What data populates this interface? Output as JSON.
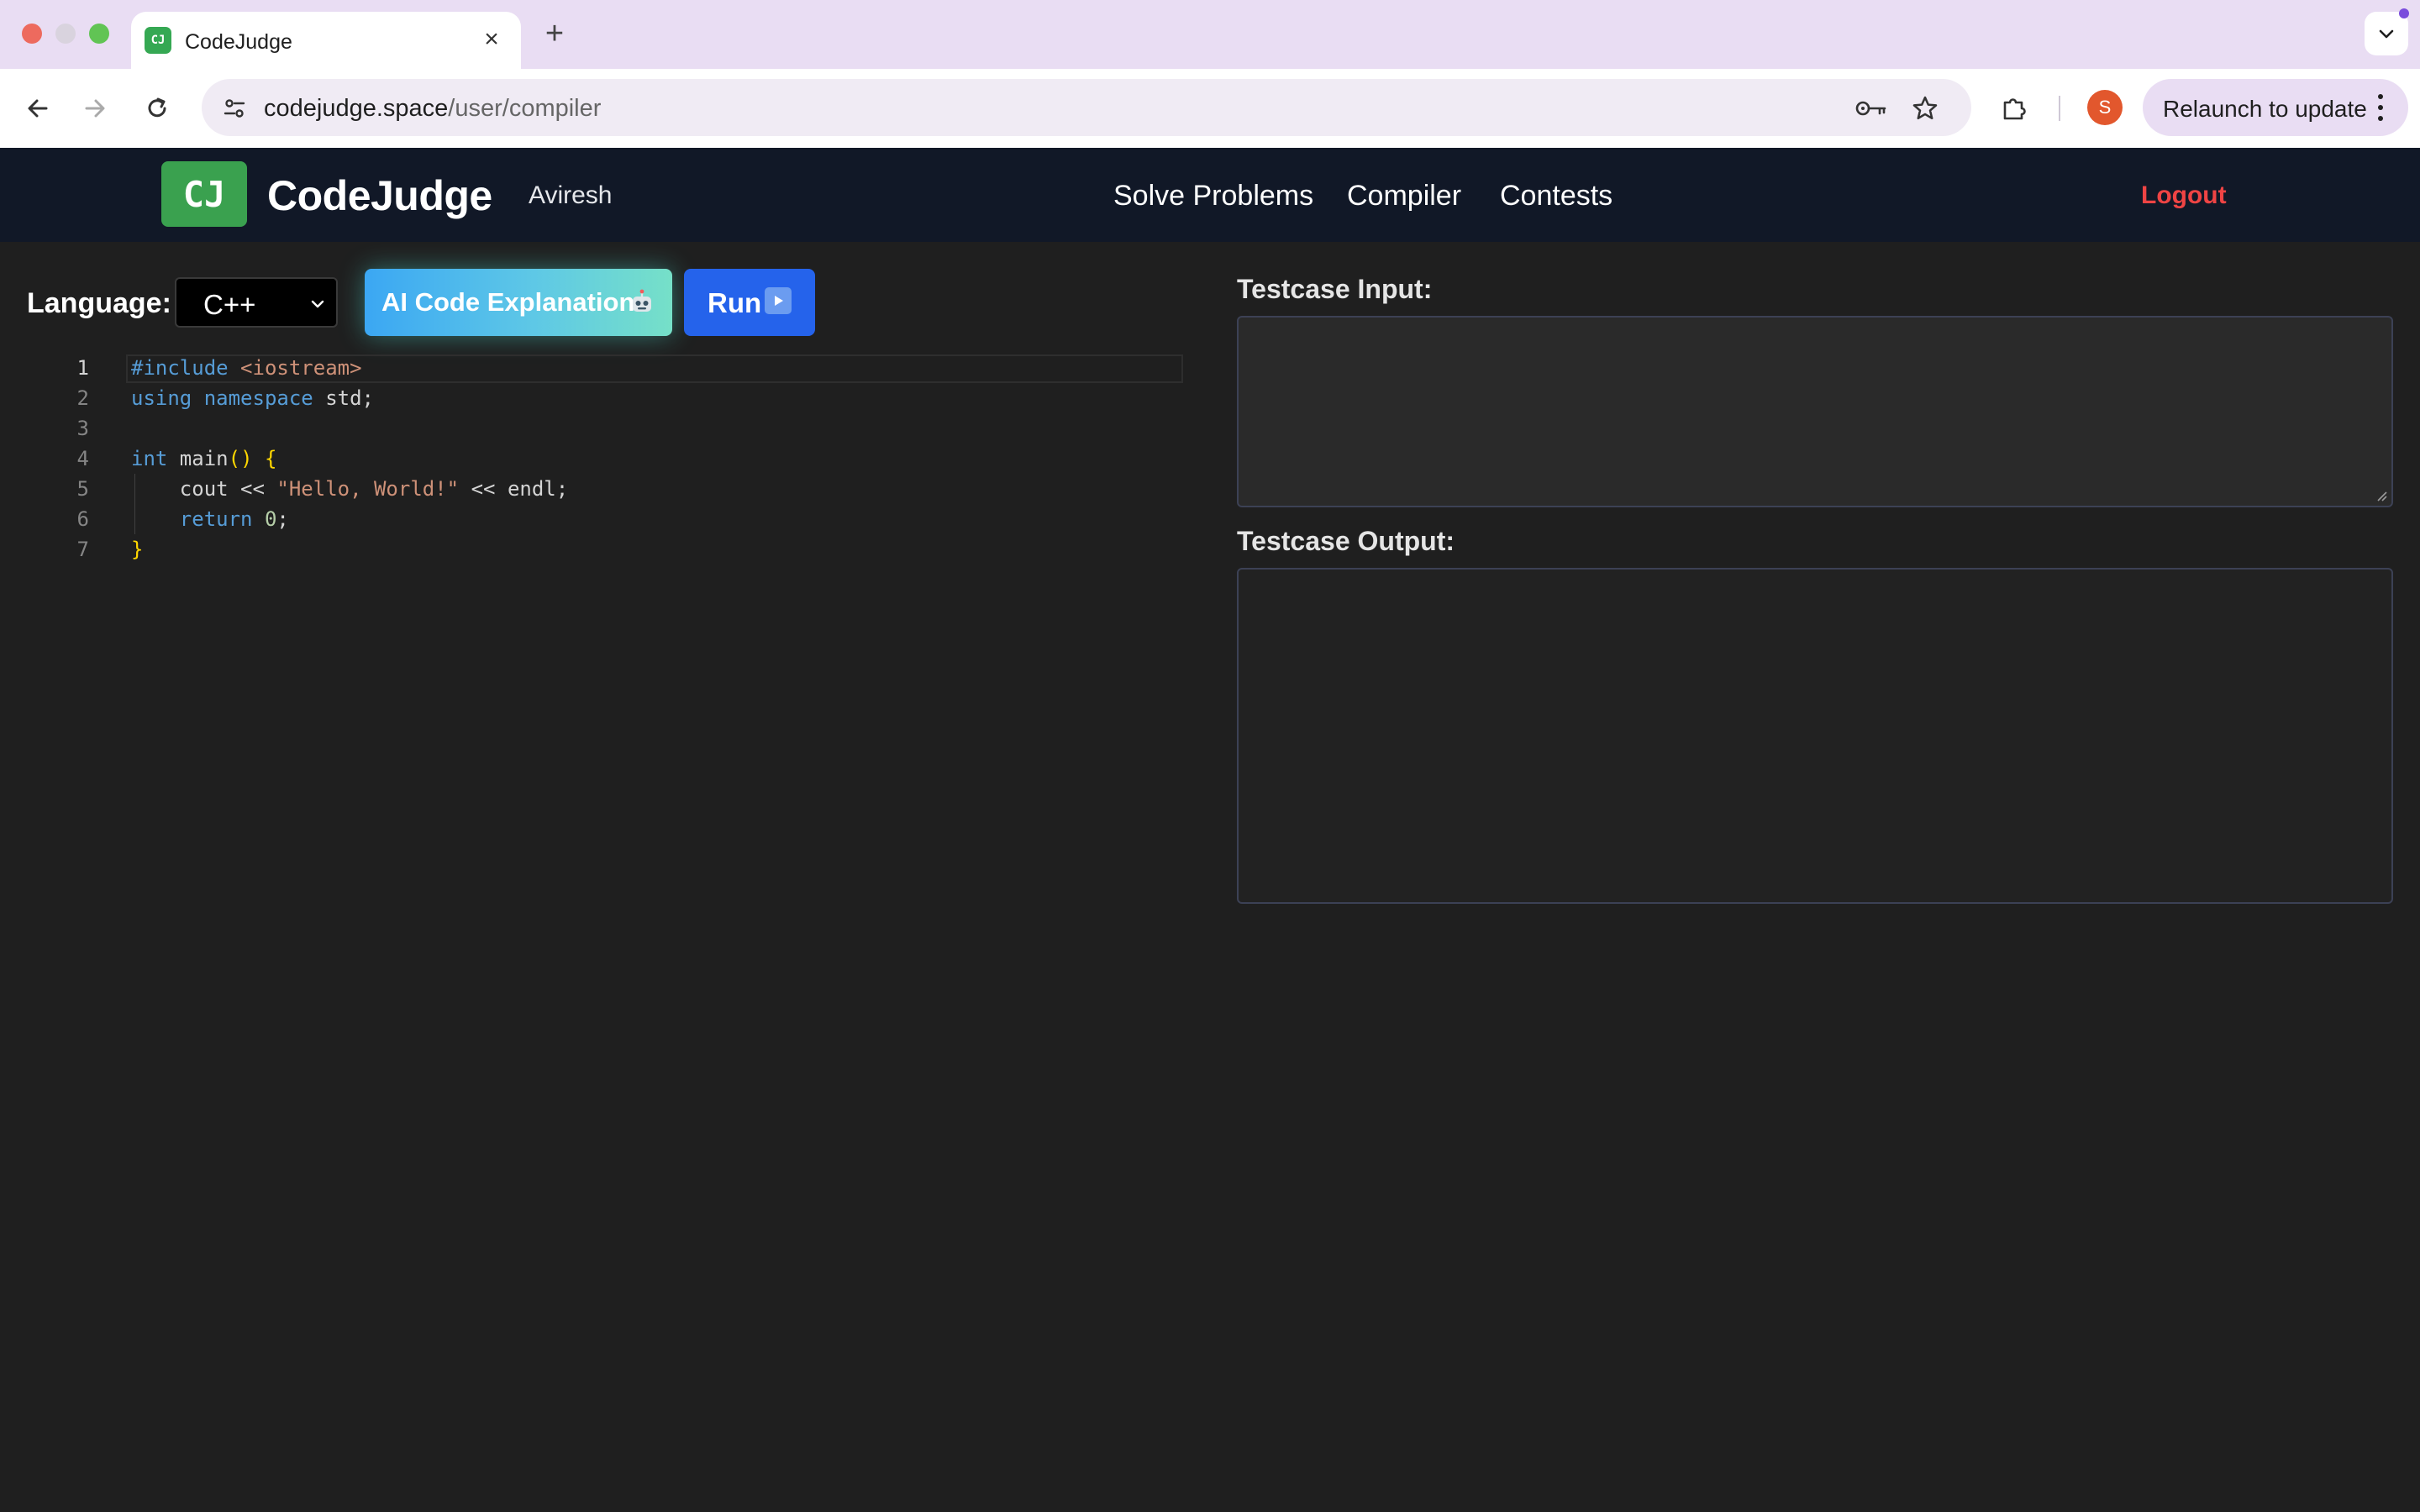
{
  "browser": {
    "tab_title": "CodeJudge",
    "tab_favicon_text": "CJ",
    "url_host": "codejudge.space",
    "url_path": "/user/compiler",
    "profile_initial": "S",
    "relaunch_label": "Relaunch to update"
  },
  "header": {
    "logo_badge": "CJ",
    "logo_text": "CodeJudge",
    "username": "Aviresh",
    "nav": [
      "Solve Problems",
      "Compiler",
      "Contests"
    ],
    "logout_label": "Logout"
  },
  "editor_toolbar": {
    "language_label": "Language:",
    "language_value": "C++",
    "ai_button_label": "AI Code Explanation",
    "run_button_label": "Run"
  },
  "code": {
    "line_numbers": [
      "1",
      "2",
      "3",
      "4",
      "5",
      "6",
      "7"
    ],
    "lines": [
      "#include <iostream>",
      "using namespace std;",
      "",
      "int main() {",
      "    cout << \"Hello, World!\" << endl;",
      "    return 0;",
      "}"
    ]
  },
  "testcase": {
    "input_label": "Testcase Input:",
    "input_value": "",
    "output_label": "Testcase Output:",
    "output_value": ""
  },
  "colors": {
    "header_bg": "#111827",
    "page_bg": "#1f1f1f",
    "logo_green": "#3aa14f",
    "run_blue": "#2563eb",
    "logout_red": "#ef4444"
  }
}
